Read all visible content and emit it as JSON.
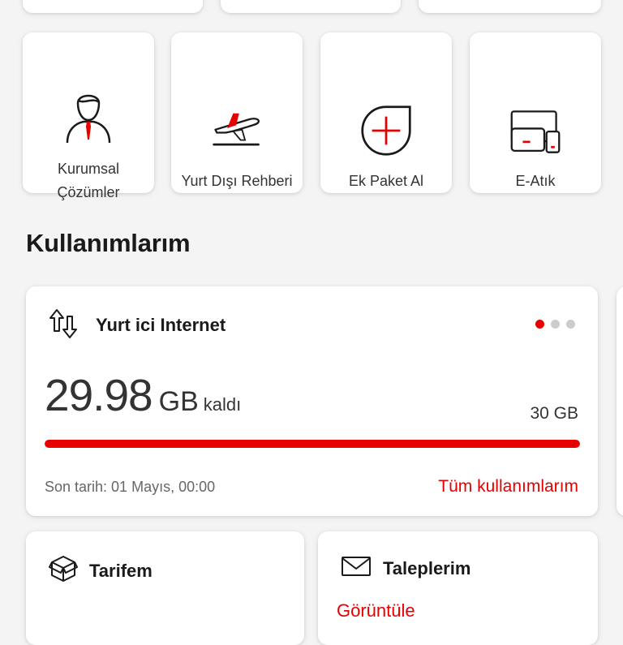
{
  "quick_tiles": [
    {
      "label_lines": [
        "Kurumsal",
        "Çözümler"
      ],
      "icon": "businessman-icon"
    },
    {
      "label_lines": [
        "Yurt Dışı Rehberi"
      ],
      "icon": "airplane-departure-icon"
    },
    {
      "label_lines": [
        "Ek Paket Al"
      ],
      "icon": "add-package-icon"
    },
    {
      "label_lines": [
        "E-Atık"
      ],
      "icon": "e-waste-devices-icon"
    }
  ],
  "section_title": "Kullanımlarım",
  "usage_card": {
    "title": "Yurt ici Internet",
    "icon": "data-transfer-icon",
    "remaining_value": "29.98",
    "remaining_unit": "GB",
    "remaining_suffix": "kaldı",
    "total": "30 GB",
    "remaining_fraction": 0.9993,
    "deadline": "Son tarih: 01 Mayıs, 00:00",
    "all_usage_link": "Tüm kullanımlarım",
    "page_dots": 3,
    "active_dot": 0
  },
  "bottom_cards": [
    {
      "title": "Tarifem",
      "icon": "package-box-icon"
    },
    {
      "title": "Taleplerim",
      "icon": "envelope-icon",
      "link": "Görüntüle"
    }
  ],
  "colors": {
    "accent": "#e60000",
    "background": "#f4f4f4",
    "card": "#ffffff",
    "track": "#e6e6e6",
    "inactive_dot": "#cccccc"
  }
}
